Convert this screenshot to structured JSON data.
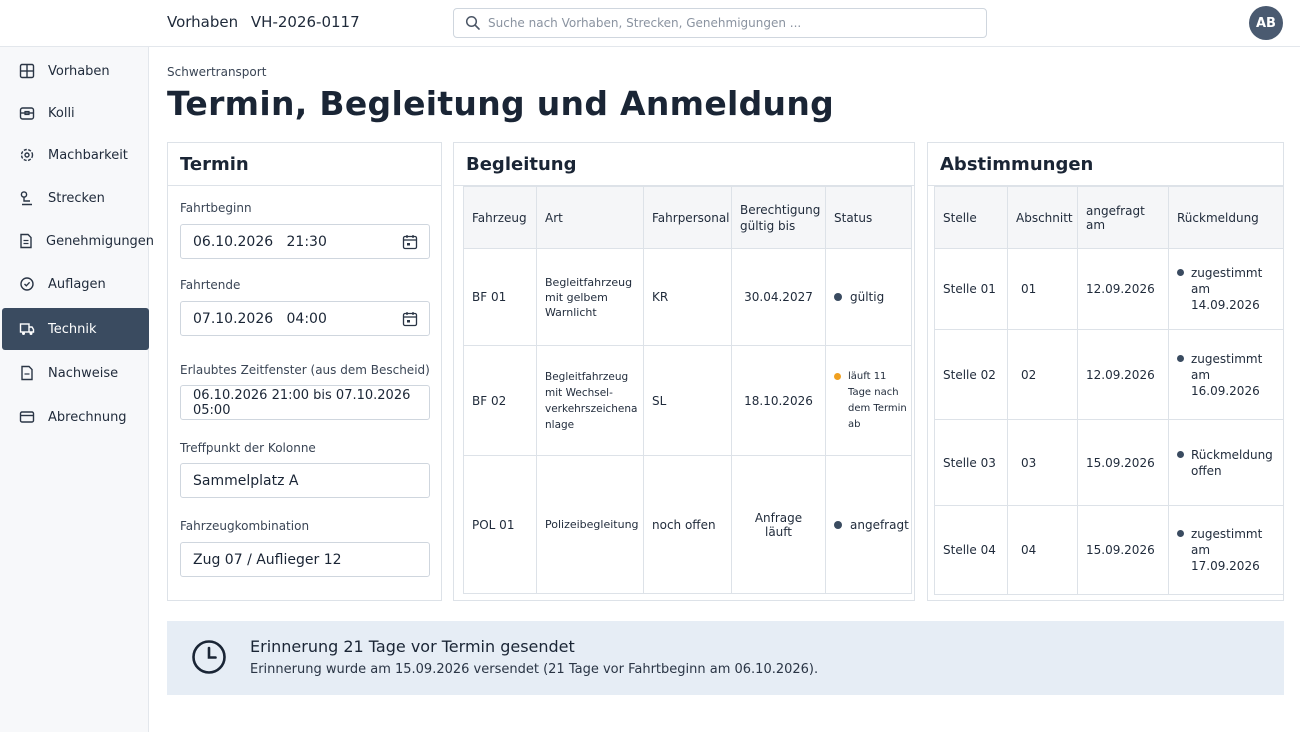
{
  "header": {
    "section": "Vorhaben",
    "project_id": "VH-2026-0117",
    "search_placeholder": "Suche nach Vorhaben, Strecken, Genehmigungen ...",
    "avatar_initials": "AB"
  },
  "sidebar": {
    "items": [
      {
        "label": "Vorhaben",
        "icon": "grid-icon"
      },
      {
        "label": "Kolli",
        "icon": "box-icon"
      },
      {
        "label": "Machbarkeit",
        "icon": "target-gear-icon"
      },
      {
        "label": "Strecken",
        "icon": "route-icon"
      },
      {
        "label": "Genehmigungen",
        "icon": "document-icon"
      },
      {
        "label": "Auflagen",
        "icon": "badge-icon"
      },
      {
        "label": "Technik",
        "icon": "truck-icon",
        "active": true
      },
      {
        "label": "Nachweise",
        "icon": "file-icon"
      },
      {
        "label": "Abrechnung",
        "icon": "card-icon"
      }
    ]
  },
  "page": {
    "eyebrow": "Schwertransport",
    "title": "Termin, Begleitung und Anmeldung"
  },
  "termin": {
    "title": "Termin",
    "fahrtbeginn_label": "Fahrtbeginn",
    "fahrtbeginn_value": "06.10.2026   21:30",
    "fahrtende_label": "Fahrtende",
    "fahrtende_value": "07.10.2026   04:00",
    "zeitfenster_label": "Erlaubtes Zeitfenster (aus dem Bescheid)",
    "zeitfenster_value": "06.10.2026 21:00 bis 07.10.2026 05:00",
    "treffpunkt_label": "Treffpunkt der Kolonne",
    "treffpunkt_value": "Sammelplatz A",
    "kombination_label": "Fahrzeugkombination",
    "kombination_value": "Zug 07 / Auflieger 12"
  },
  "begleitung": {
    "title": "Begleitung",
    "columns": [
      "Fahrzeug",
      "Art",
      "Fahrpersonal",
      "Berechtigung gültig bis",
      "Status"
    ],
    "rows": [
      {
        "fahrzeug": "BF 01",
        "art": "Begleitfahrzeug mit gelbem Warnlicht",
        "personal": "KR",
        "gueltig": "30.04.2027",
        "status": "gültig",
        "status_color": "#3a4b60"
      },
      {
        "fahrzeug": "BF 02",
        "art": "Begleitfahrzeug mit Wechsel-verkehrszeichenanlage",
        "personal": "SL",
        "gueltig": "18.10.2026",
        "status": "läuft 11 Tage nach dem Termin ab",
        "status_color": "#f0a020"
      },
      {
        "fahrzeug": "POL 01",
        "art": "Polizeibegleitung",
        "personal": "noch offen",
        "gueltig": "Anfrage läuft",
        "status": "angefragt",
        "status_color": "#3a4b60"
      }
    ]
  },
  "abstimmungen": {
    "title": "Abstimmungen",
    "columns": [
      "Stelle",
      "Abschnitt",
      "angefragt am",
      "Rückmeldung"
    ],
    "rows": [
      {
        "stelle": "Stelle 01",
        "abschnitt": "01",
        "angefragt": "12.09.2026",
        "rueckmeldung": "zugestimmt am 14.09.2026"
      },
      {
        "stelle": "Stelle 02",
        "abschnitt": "02",
        "angefragt": "12.09.2026",
        "rueckmeldung": "zugestimmt am 16.09.2026"
      },
      {
        "stelle": "Stelle 03",
        "abschnitt": "03",
        "angefragt": "15.09.2026",
        "rueckmeldung": "Rückmeldung offen"
      },
      {
        "stelle": "Stelle 04",
        "abschnitt": "04",
        "angefragt": "15.09.2026",
        "rueckmeldung": "zugestimmt am 17.09.2026"
      }
    ]
  },
  "banner": {
    "title": "Erinnerung 21 Tage vor Termin gesendet",
    "text": "Erinnerung wurde am 15.09.2026 versendet (21 Tage vor Fahrtbeginn am 06.10.2026).",
    "icon": "clock-icon"
  },
  "colors": {
    "accent": "#3a4b60",
    "status_warning": "#f0a020",
    "banner_bg": "#e6edf5"
  }
}
